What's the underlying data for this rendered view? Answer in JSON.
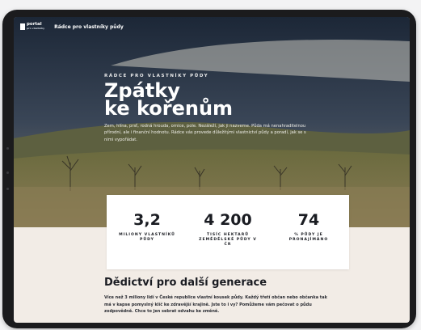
{
  "nav": {
    "logo_text": "portal",
    "logo_sub": "pro vlastníky",
    "link_label": "Rádce pro vlastníky půdy"
  },
  "hero": {
    "eyebrow": "RÁDCE PRO VLASTNÍKY PŮDY",
    "title_line1": "Zpátky",
    "title_line2": "ke kořenům",
    "lead": "Zem, hlína, prsť, rodná hrouda, ornice, pole. Nezáleží, jak ji nazveme. Půda má nenahraditelnou přírodní, ale i finanční hodnotu. Rádce vás provede důležitými vlastnictví půdy a poradí, jak se s nimi vypořádat."
  },
  "stats": [
    {
      "value": "3,2",
      "label": "MILIONY VLASTNÍKŮ PŮDY"
    },
    {
      "value": "4 200",
      "label": "TISÍC HEKTARŮ ZEMĚDĚLSKÉ PŮDY V ČR"
    },
    {
      "value": "74",
      "label": "% PŮDY JE PRONAJÍMÁNO"
    }
  ],
  "section": {
    "heading": "Dědictví pro další generace",
    "text": "Více než 3 miliony lidí v České republice vlastní kousek půdy. Každý třetí občan nebo občanka tak má v kapse pomyslný klíč ke zdravější krajině. Jste to i vy? Pomůžeme vám pečovat o půdu zodpovědně. Chce to jen sebrat odvahu ke změně."
  },
  "colors": {
    "device": "#1b1b1d",
    "stats_bg": "#ffffff",
    "page_bg": "#f2ece6"
  }
}
